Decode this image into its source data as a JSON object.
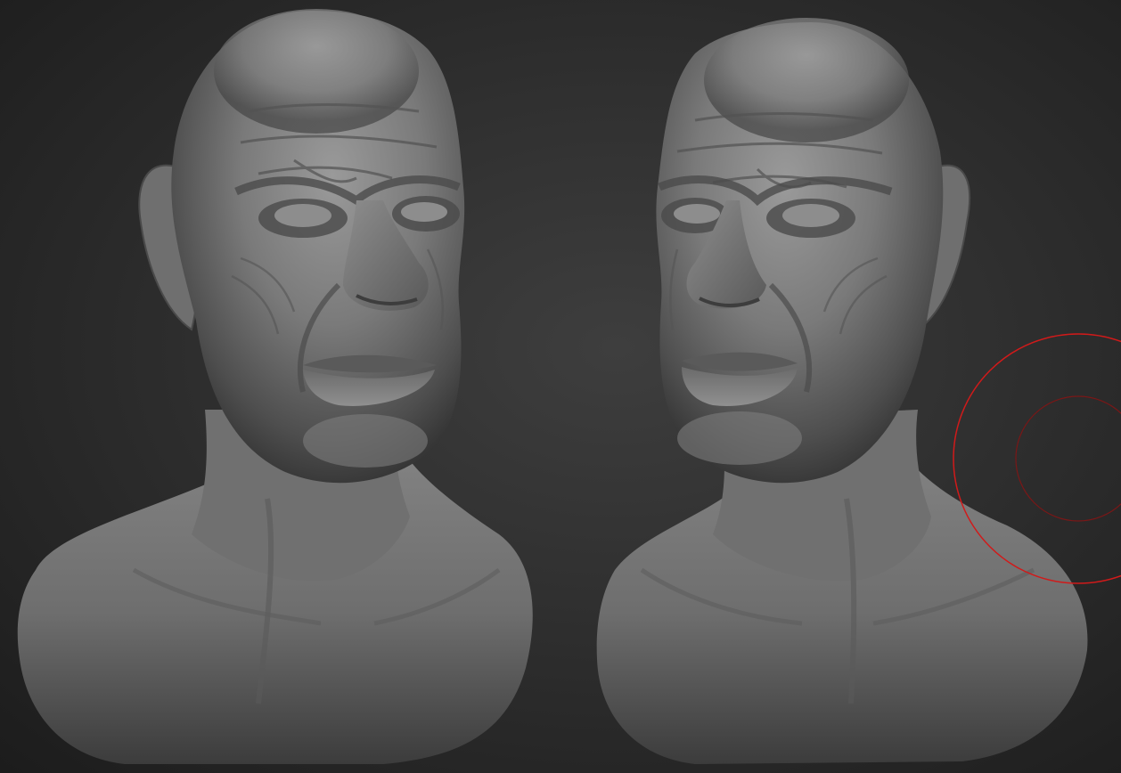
{
  "viewport": {
    "description_free": true,
    "background_color": "#2c2c2c",
    "material_color": "#8a8a8a"
  },
  "models": [
    {
      "name": "head-bust-front-left",
      "view": "three-quarter-left"
    },
    {
      "name": "head-bust-front-right",
      "view": "three-quarter-right"
    }
  ],
  "brush_cursor": {
    "icon": "brush-cursor-icon",
    "outer_color": "#d11a1a",
    "inner_color": "#7a1717"
  }
}
